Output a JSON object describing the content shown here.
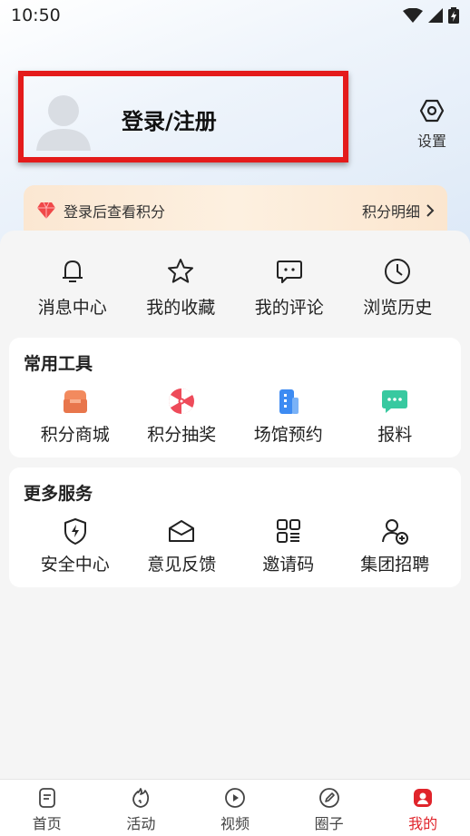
{
  "status_bar": {
    "time": "10:50",
    "icons": [
      "wifi-icon",
      "signal-icon",
      "battery-icon"
    ]
  },
  "profile": {
    "login_label": "登录/注册",
    "settings_label": "设置"
  },
  "points_banner": {
    "text": "登录后查看积分",
    "detail_label": "积分明细"
  },
  "quick_actions": [
    {
      "label": "消息中心",
      "icon": "bell-icon"
    },
    {
      "label": "我的收藏",
      "icon": "star-icon"
    },
    {
      "label": "我的评论",
      "icon": "comment-icon"
    },
    {
      "label": "浏览历史",
      "icon": "clock-icon"
    }
  ],
  "tools": {
    "title": "常用工具",
    "items": [
      {
        "label": "积分商城",
        "icon": "shop-icon"
      },
      {
        "label": "积分抽奖",
        "icon": "lottery-wheel-icon"
      },
      {
        "label": "场馆预约",
        "icon": "building-icon"
      },
      {
        "label": "报料",
        "icon": "chat-dots-icon"
      }
    ]
  },
  "services": {
    "title": "更多服务",
    "items": [
      {
        "label": "安全中心",
        "icon": "shield-bolt-icon"
      },
      {
        "label": "意见反馈",
        "icon": "envelope-icon"
      },
      {
        "label": "邀请码",
        "icon": "qr-grid-icon"
      },
      {
        "label": "集团招聘",
        "icon": "user-add-icon"
      }
    ]
  },
  "tabbar": [
    {
      "label": "首页",
      "icon": "document-icon",
      "active": false
    },
    {
      "label": "活动",
      "icon": "flame-icon",
      "active": false
    },
    {
      "label": "视频",
      "icon": "play-icon",
      "active": false
    },
    {
      "label": "圈子",
      "icon": "pen-icon",
      "active": false
    },
    {
      "label": "我的",
      "icon": "profile-icon",
      "active": true
    }
  ],
  "colors": {
    "accent": "#e0242b",
    "highlight_box": "#e41b1b"
  }
}
